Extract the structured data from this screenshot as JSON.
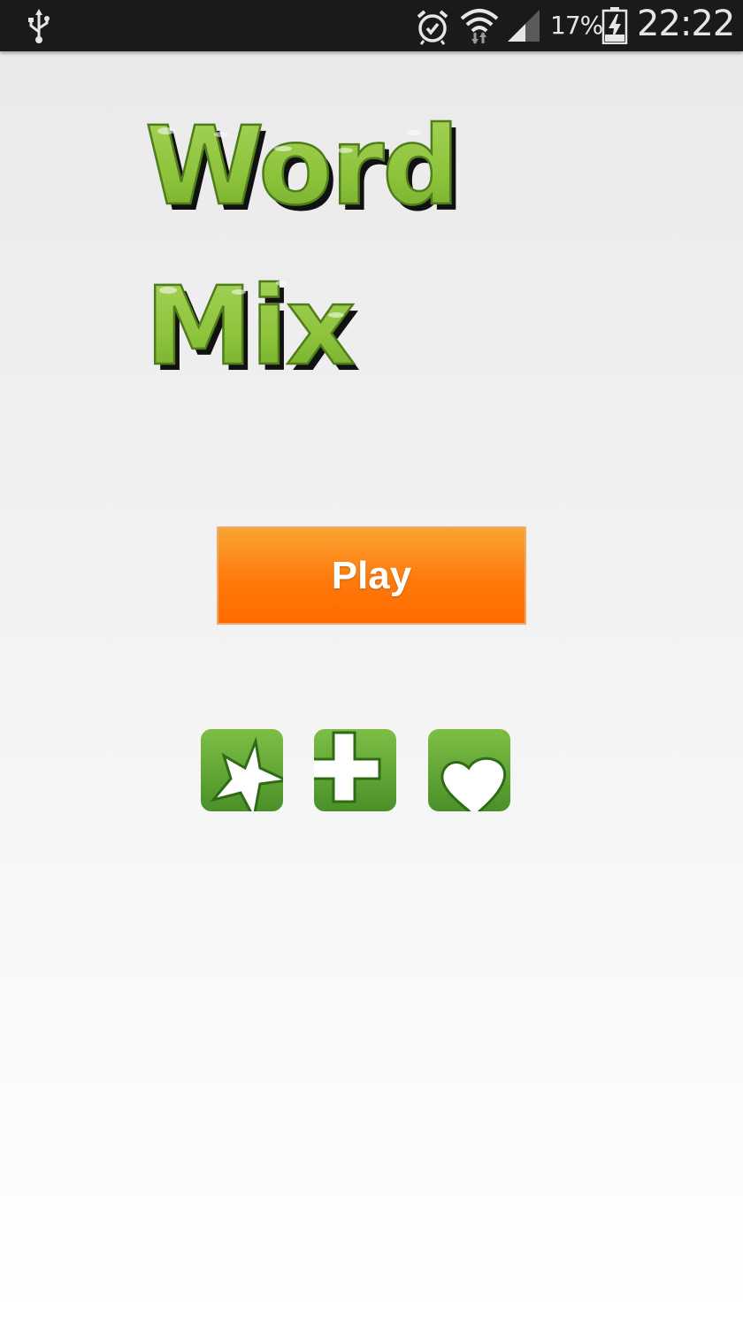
{
  "status_bar": {
    "battery_percent": "17%",
    "time": "22:22",
    "icons": [
      "usb-icon",
      "alarm-icon",
      "wifi-icon",
      "signal-icon",
      "battery-charging-icon"
    ]
  },
  "app": {
    "title_line1": "Word",
    "title_line2": "Mix",
    "logo_color": "#8cc23a"
  },
  "menu": {
    "play_label": "Play",
    "play_color": "#ff7a0c"
  },
  "actions": [
    {
      "icon": "star-icon",
      "action": "rate"
    },
    {
      "icon": "plus-icon",
      "action": "more"
    },
    {
      "icon": "heart-icon",
      "action": "favorite"
    }
  ],
  "colors": {
    "action_green": "#5fa535"
  }
}
